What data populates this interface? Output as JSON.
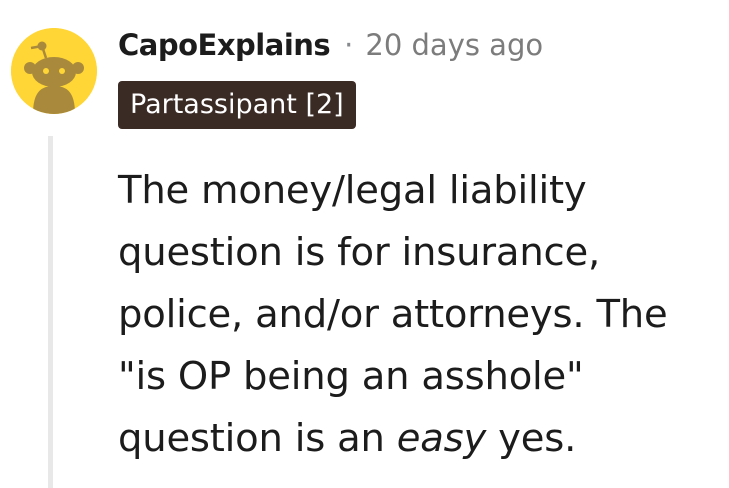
{
  "comment": {
    "author": "CapoExplains",
    "separator": "·",
    "timestamp": "20 days ago",
    "flair": "Partassipant [2]",
    "avatar_icon": "snoo-avatar-icon",
    "body": {
      "before_emphasis": "The money/legal liability question is for insurance, police, and/or attorneys. The \"is OP being an asshole\" question is an ",
      "emphasis": "easy",
      "after_emphasis": " yes."
    }
  },
  "colors": {
    "avatar_bg": "#ffd635",
    "avatar_figure": "#a98a3c",
    "flair_bg": "#3b2b25",
    "flair_text": "#ffffff",
    "meta_text": "#7c7c7c",
    "thread_line": "#e8e8e8"
  }
}
